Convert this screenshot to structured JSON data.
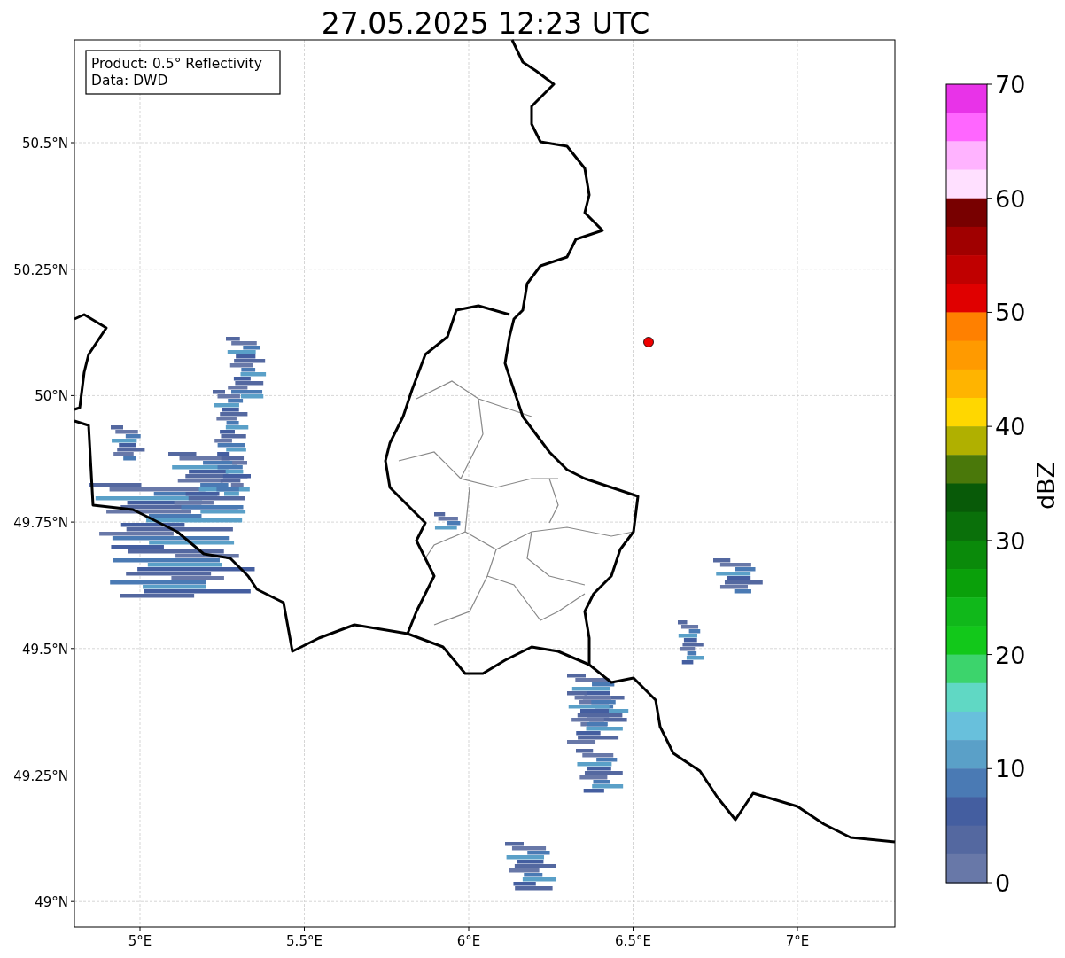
{
  "title": "27.05.2025 12:23 UTC",
  "info_box": [
    "Product: 0.5° Reflectivity",
    "Data: DWD"
  ],
  "map": {
    "lat_labels": [
      "50.5°N",
      "50.25°N",
      "50°N",
      "49.75°N",
      "49.5°N",
      "49.25°N",
      "49°N"
    ],
    "lon_labels": [
      "5°E",
      "5.5°E",
      "6°E",
      "6.5°E",
      "7°E"
    ]
  },
  "colorbar": {
    "label": "dBZ",
    "ticks": [
      "70",
      "60",
      "50",
      "40",
      "30",
      "20",
      "10",
      "0"
    ],
    "bins": [
      {
        "color": "#e833e8"
      },
      {
        "color": "#ff66ff"
      },
      {
        "color": "#ffb3ff"
      },
      {
        "color": "#ffe0ff"
      },
      {
        "color": "#780000"
      },
      {
        "color": "#a00000"
      },
      {
        "color": "#c00000"
      },
      {
        "color": "#e00000"
      },
      {
        "color": "#ff8000"
      },
      {
        "color": "#ff9a00"
      },
      {
        "color": "#ffb400"
      },
      {
        "color": "#ffd700"
      },
      {
        "color": "#b0b000"
      },
      {
        "color": "#4a780a"
      },
      {
        "color": "#085a08"
      },
      {
        "color": "#0a700a"
      },
      {
        "color": "#0a8a0a"
      },
      {
        "color": "#0aa00a"
      },
      {
        "color": "#10b81a"
      },
      {
        "color": "#12c81a"
      },
      {
        "color": "#3cd46c"
      },
      {
        "color": "#60d8c4"
      },
      {
        "color": "#68c0dc"
      },
      {
        "color": "#5aa0c8"
      },
      {
        "color": "#4a7ab4"
      },
      {
        "color": "#445ea0"
      },
      {
        "color": "#5468a0"
      },
      {
        "color": "#6878a8"
      }
    ]
  }
}
